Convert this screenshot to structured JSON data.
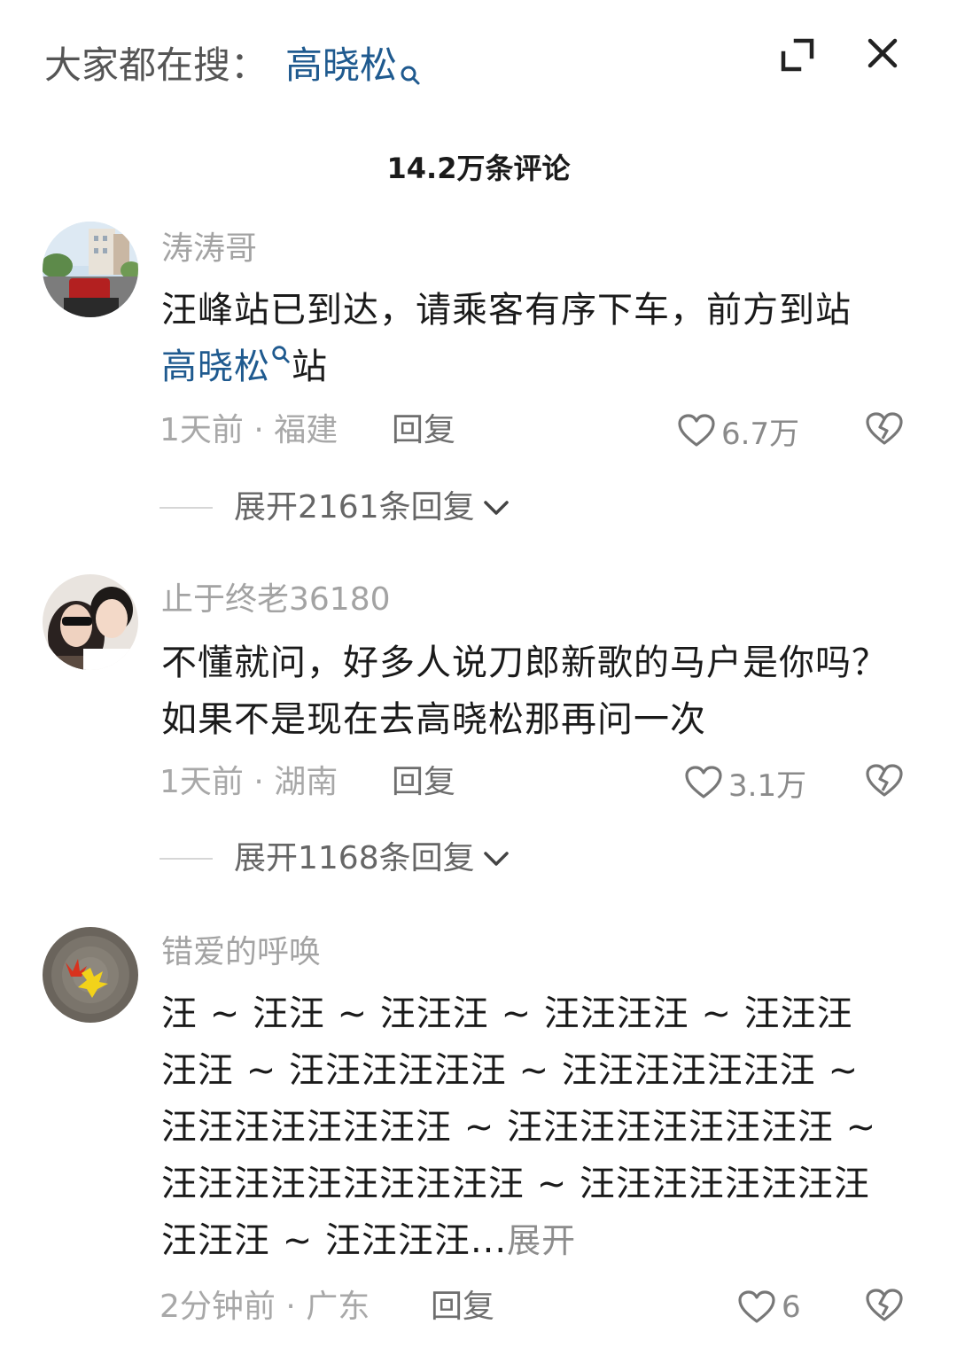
{
  "header": {
    "search_prefix": "大家都在搜：",
    "search_term": "高晓松",
    "comment_count": "14.2万条评论"
  },
  "comments": [
    {
      "username": "涛涛哥",
      "text_part1": "汪峰站已到达，请乘客有序下车，前方到站 ",
      "link": "高晓松",
      "text_part2": "站",
      "time": "1天前",
      "sep": " · ",
      "location": "福建",
      "reply": "回复",
      "likes": "6.7万",
      "replies": "展开2161条回复"
    },
    {
      "username": "止于终老36180",
      "text": "不懂就问，好多人说刀郎新歌的马户是你吗？如果不是现在去高晓松那再问一次",
      "time": "1天前",
      "sep": " · ",
      "location": "湖南",
      "reply": "回复",
      "likes": "3.1万",
      "replies": "展开1168条回复"
    },
    {
      "username": "错爱的呼唤",
      "text": "汪 ~ 汪汪 ~ 汪汪汪 ~ 汪汪汪汪 ~ 汪汪汪汪汪 ~ 汪汪汪汪汪汪 ~ 汪汪汪汪汪汪汪 ~ 汪汪汪汪汪汪汪汪 ~ 汪汪汪汪汪汪汪汪汪 ~ 汪汪汪汪汪汪汪汪汪汪 ~ 汪汪汪汪汪汪汪汪汪汪汪 ~ 汪汪汪汪...",
      "expand": "展开",
      "time": "2分钟前",
      "sep": " · ",
      "location": "广东",
      "reply": "回复",
      "likes": "6"
    }
  ],
  "icons": {
    "search": "search-icon",
    "expand": "expand-icon",
    "close": "close-icon",
    "like": "heart-icon",
    "dislike": "broken-heart-icon",
    "chevron": "chevron-down-icon"
  },
  "colors": {
    "link": "#1f5a8f",
    "text": "#1a1a1a",
    "muted": "#a8a8a8"
  }
}
